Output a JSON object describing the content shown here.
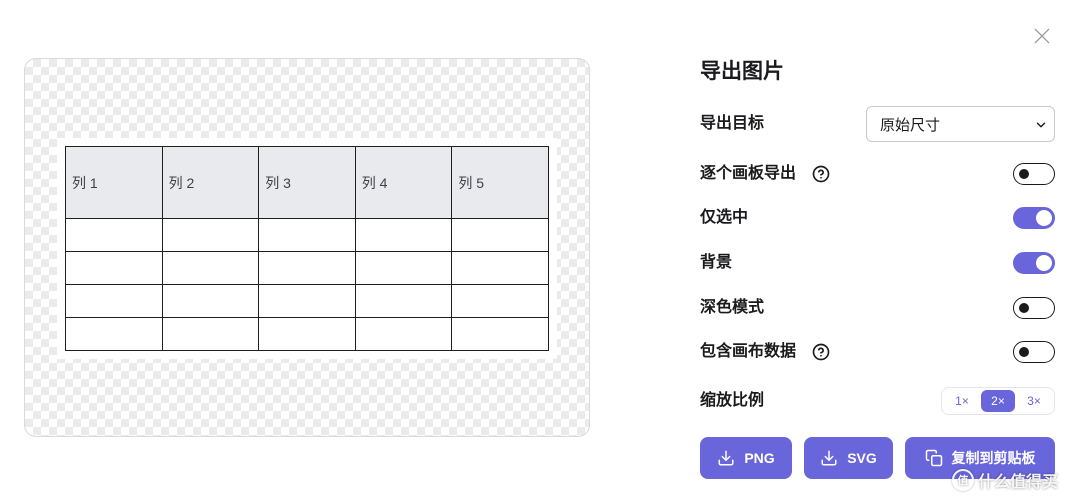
{
  "dialog": {
    "title": "导出图片"
  },
  "preview": {
    "table": {
      "headers": [
        "列 1",
        "列 2",
        "列 3",
        "列 4",
        "列 5"
      ],
      "rows": [
        [
          "",
          "",
          "",
          "",
          ""
        ],
        [
          "",
          "",
          "",
          "",
          ""
        ],
        [
          "",
          "",
          "",
          "",
          ""
        ],
        [
          "",
          "",
          "",
          "",
          ""
        ]
      ]
    }
  },
  "settings": {
    "export_target": {
      "label": "导出目标",
      "value": "原始尺寸",
      "icon": "chevron-down-icon"
    },
    "toggles": [
      {
        "label": "逐个画板导出",
        "help_icon": "help-icon",
        "checked": false
      },
      {
        "label": "仅选中",
        "checked": true
      },
      {
        "label": "背景",
        "checked": true
      },
      {
        "label": "深色模式",
        "checked": false
      },
      {
        "label": "包含画布数据",
        "help_icon": "help-icon",
        "checked": false
      }
    ],
    "scale": {
      "label": "缩放比例",
      "options": [
        "1×",
        "2×",
        "3×"
      ],
      "selected_index": 1
    }
  },
  "actions": {
    "png": {
      "label": "PNG",
      "icon": "download-icon"
    },
    "svg": {
      "label": "SVG",
      "icon": "download-icon"
    },
    "copy": {
      "label": "复制到剪贴板",
      "icon": "copy-icon"
    }
  },
  "icons": {
    "close": "close-icon"
  },
  "colors": {
    "accent": "#6965db",
    "text": "#1b1b1f",
    "table_header": "#e8eaed"
  },
  "watermark": {
    "logo_text": "值",
    "text": "什么值得买"
  }
}
